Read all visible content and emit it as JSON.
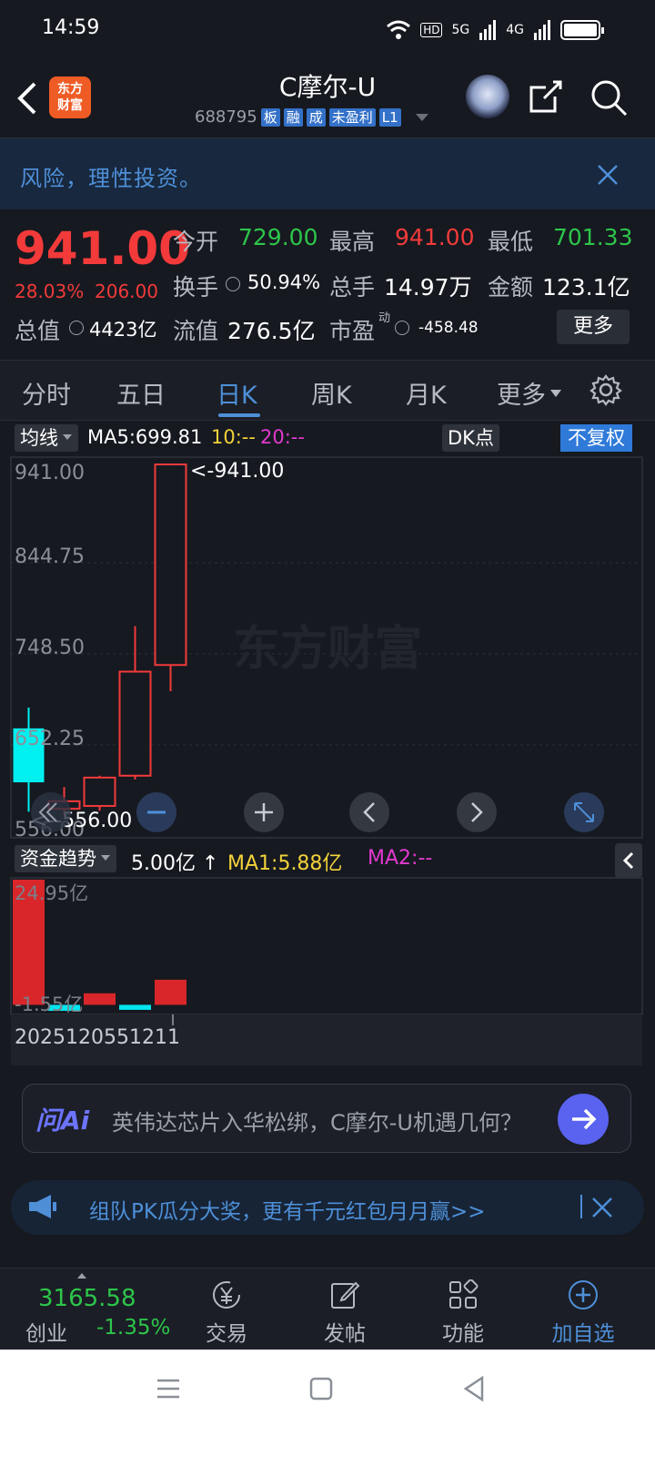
{
  "status": {
    "time": "14:59",
    "signal1": "5G",
    "signal2": "4G",
    "hd": "HD"
  },
  "header": {
    "logo": "东方财富",
    "title": "C摩尔-U",
    "code": "688795",
    "tags": [
      "板",
      "融",
      "成",
      "未盈利",
      "L1"
    ]
  },
  "risk": {
    "text": "风险，理性投资。"
  },
  "quote": {
    "price": "941.00",
    "change_pct": "28.03%",
    "change_amt": "206.00",
    "open_label": "今开",
    "open": "729.00",
    "high_label": "最高",
    "high": "941.00",
    "low_label": "最低",
    "low": "701.33",
    "turnover_label": "换手",
    "turnover": "50.94%",
    "volume_label": "总手",
    "volume": "14.97万",
    "amount_label": "金额",
    "amount": "123.1亿",
    "mktcap_label": "总值",
    "mktcap": "4423亿",
    "float_label": "流值",
    "float": "276.5亿",
    "pe_label": "市盈",
    "pe_sup": "动",
    "pe": "-458.48",
    "more": "更多"
  },
  "tabs": [
    "分时",
    "五日",
    "日K",
    "周K",
    "月K",
    "更多"
  ],
  "active_tab": 2,
  "kline": {
    "ma_button": "均线",
    "ma5": "MA5:699.81",
    "ma10": "10:--",
    "ma20": "20:--",
    "dk": "DK点",
    "adjust": "不复权",
    "y_ticks": [
      "941.00",
      "844.75",
      "748.50",
      "652.25",
      "556.00"
    ],
    "max_label": "<-941.00",
    "min_label": "<--556.00",
    "watermark": "东方财富",
    "candles": [
      {
        "open": 662,
        "close": 605,
        "high": 684,
        "low": 574
      },
      {
        "open": 577,
        "close": 585,
        "high": 600,
        "low": 570
      },
      {
        "open": 580,
        "close": 610,
        "high": 612,
        "low": 575
      },
      {
        "open": 612,
        "close": 722,
        "high": 770,
        "low": 608
      },
      {
        "open": 729,
        "close": 941,
        "high": 941,
        "low": 701.33
      }
    ],
    "ymin": 556,
    "ymax": 941
  },
  "funds": {
    "label": "资金趋势",
    "value": "5.00亿",
    "ma1": "MA1:5.88亿",
    "ma2": "MA2:--",
    "top": "24.95亿",
    "bottom": "-1.55亿",
    "bars": [
      24.95,
      -1.2,
      2.3,
      -1.0,
      5.0
    ],
    "vmax": 24.95,
    "vmin": -1.55
  },
  "dates": {
    "start": "20251205",
    "end": "51211"
  },
  "ask": {
    "brand": "问Ai",
    "text": "英伟达芯片入华松绑，C摩尔-U机遇几何？"
  },
  "promo": {
    "text": "组队PK瓜分大奖，更有千元红包月月赢>>"
  },
  "bottom": {
    "index_value": "3165.58",
    "index_name": "创业",
    "index_change": "-1.35%",
    "items": [
      "交易",
      "发帖",
      "功能",
      "加自选"
    ]
  },
  "colors": {
    "up": "#f23a3a",
    "down": "#00f0f0",
    "accent": "#4e8fd8"
  }
}
